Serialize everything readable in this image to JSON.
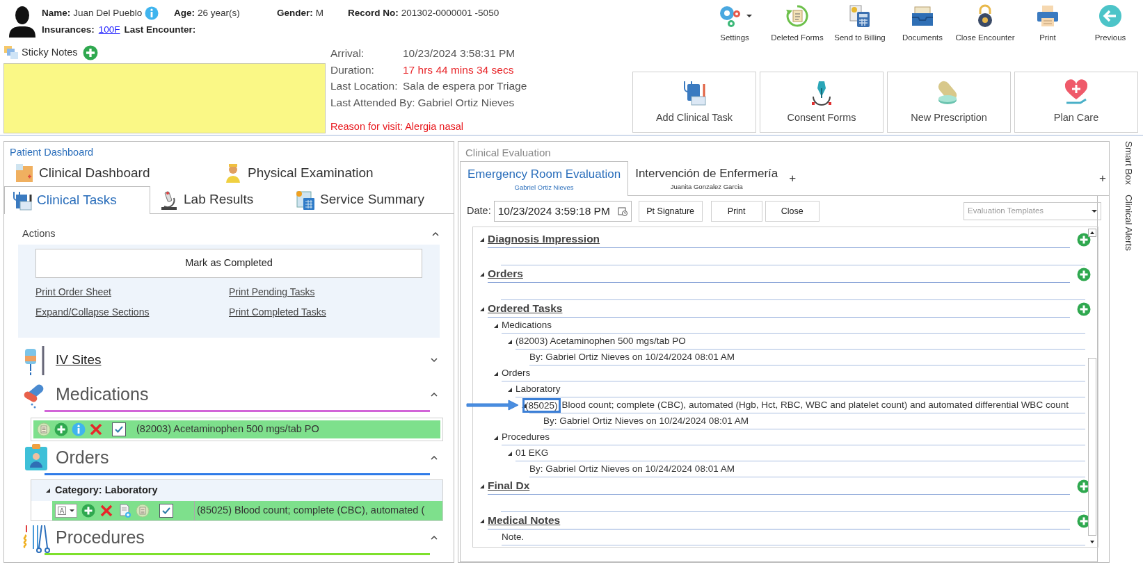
{
  "patient": {
    "name_label": "Name:",
    "name": "Juan Del Pueblo",
    "age_label": "Age:",
    "age": "26 year(s)",
    "gender_label": "Gender:",
    "gender": "M",
    "record_label": "Record No:",
    "record": "201302-0000001 -5050",
    "insurances_label": "Insurances:",
    "insurance": "100F",
    "last_encounter_label": "Last Encounter:"
  },
  "toolbar": [
    {
      "kind": "settings",
      "label": "Settings",
      "menu": true
    },
    {
      "kind": "deleted",
      "label": "Deleted Forms",
      "menu": false
    },
    {
      "kind": "billing",
      "label": "Send to Billing",
      "menu": false
    },
    {
      "kind": "documents",
      "label": "Documents",
      "menu": false
    },
    {
      "kind": "close",
      "label": "Close Encounter",
      "menu": false
    },
    {
      "kind": "print",
      "label": "Print",
      "menu": false
    },
    {
      "kind": "previous",
      "label": "Previous",
      "menu": false
    }
  ],
  "sticky_notes": {
    "label": "Sticky Notes"
  },
  "visit": {
    "rows": [
      {
        "label": "Arrival:",
        "value": "10/23/2024 3:58:31 PM",
        "alert": false
      },
      {
        "label": "Duration:",
        "value": "17 hrs 44 mins 34 secs",
        "alert": true
      },
      {
        "label": "Last Location:",
        "value": "Sala de espera por Triage",
        "alert": false
      },
      {
        "label": "Last Attended By:",
        "value": "Gabriel Ortiz Nieves",
        "alert": false
      }
    ],
    "reason": "Reason for visit: Alergia nasal"
  },
  "quick_actions": [
    {
      "kind": "task",
      "label": "Add Clinical Task"
    },
    {
      "kind": "consent",
      "label": "Consent Forms"
    },
    {
      "kind": "prescription",
      "label": "New Prescription"
    },
    {
      "kind": "plan",
      "label": "Plan Care"
    }
  ],
  "patient_dashboard": {
    "title": "Patient Dashboard",
    "tab_rows": [
      {
        "tabs": [
          {
            "kind": "dashboard",
            "label": "Clinical Dashboard",
            "selected": false
          },
          {
            "kind": "exam",
            "label": "Physical Examination",
            "selected": false
          }
        ]
      },
      {
        "tabs": [
          {
            "kind": "tasks",
            "label": "Clinical Tasks",
            "selected": true
          },
          {
            "kind": "lab",
            "label": "Lab Results",
            "selected": false
          },
          {
            "kind": "summary",
            "label": "Service Summary",
            "selected": false
          }
        ]
      }
    ],
    "actions": {
      "title": "Actions",
      "expanded": true,
      "button": "Mark as Completed",
      "links": [
        "Print Order Sheet",
        "Print Pending Tasks",
        "Expand/Collapse Sections",
        "Print Completed Tasks"
      ]
    },
    "sections": [
      {
        "kind": "iv",
        "title": "IV Sites",
        "expanded": false
      },
      {
        "kind": "medications",
        "title": "Medications",
        "expanded": true,
        "color": "#d264d8",
        "rows": [
          {
            "text": "(82003) Acetaminophen 500 mgs/tab PO",
            "checked": true
          }
        ]
      },
      {
        "kind": "orders",
        "title": "Orders",
        "expanded": true,
        "color": "#2f7be8",
        "category": "Category: Laboratory",
        "rows": [
          {
            "text": "(85025) Blood count; complete (CBC), automated (",
            "checked": true
          }
        ]
      },
      {
        "kind": "procedures",
        "title": "Procedures",
        "expanded": true,
        "color": "#7ee02c"
      }
    ]
  },
  "clinical_evaluation": {
    "title": "Clinical Evaluation",
    "tabs": [
      {
        "title": "Emergency Room Evaluation",
        "author": "Gabriel Ortiz Nieves",
        "selected": true
      },
      {
        "title": "Intervención de Enfermería",
        "author": "Juanita Gonzalez Garcia",
        "selected": false
      }
    ],
    "add_tab": "+",
    "add_panel": "+",
    "date_label": "Date:",
    "date": "10/23/2024 3:59:18 PM",
    "buttons": [
      "Pt Signature",
      "Print",
      "Close"
    ],
    "templates_placeholder": "Evaluation Templates",
    "sections": [
      {
        "title": "Diagnosis Impression"
      },
      {
        "title": "Orders"
      },
      {
        "title": "Ordered Tasks",
        "children": [
          {
            "label": "Medications",
            "children": [
              {
                "label": "(82003) Acetaminophen 500 mgs/tab PO",
                "children": [
                  {
                    "label": "By: Gabriel Ortiz Nieves on 10/24/2024 08:01 AM"
                  }
                ]
              }
            ]
          },
          {
            "label": "Orders",
            "children": [
              {
                "label": "Laboratory",
                "children": [
                  {
                    "code": "(85025)",
                    "highlighted": true,
                    "label": "Blood count; complete (CBC), automated (Hgb, Hct, RBC, WBC and platelet count) and automated differential WBC count",
                    "children": [
                      {
                        "label": "By: Gabriel Ortiz Nieves on 10/24/2024 08:01 AM"
                      }
                    ]
                  }
                ]
              }
            ]
          },
          {
            "label": "Procedures",
            "children": [
              {
                "label": "01 EKG",
                "children": [
                  {
                    "label": "By: Gabriel Ortiz Nieves on 10/24/2024 08:01 AM"
                  }
                ]
              }
            ]
          }
        ]
      },
      {
        "title": "Final Dx"
      },
      {
        "title": "Medical Notes",
        "children": [
          {
            "label": "Note."
          }
        ]
      }
    ]
  },
  "side_tabs": [
    "Smart Box",
    "Clinical Alerts"
  ]
}
